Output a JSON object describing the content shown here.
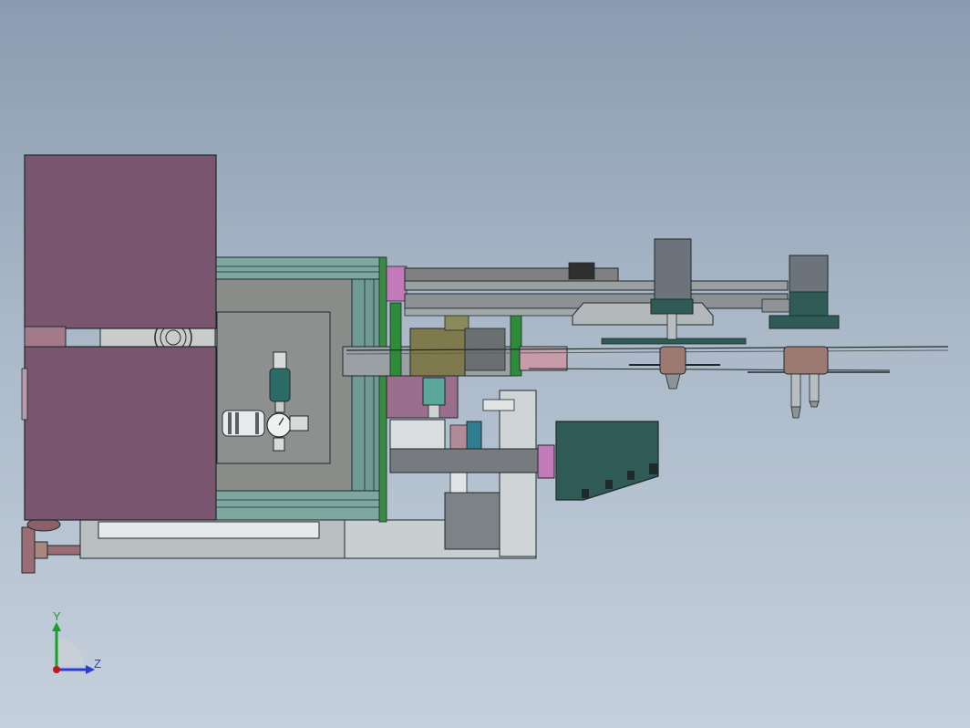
{
  "viewport": {
    "background_top": "#8a9cb1",
    "background_bottom": "#c5d0dc"
  },
  "colors": {
    "cabinet_purple": "#795570",
    "frame_teal": "#7ea89f",
    "panel_gray": "#8a8c8a",
    "outline": "#1f2a2a",
    "green_part": "#2e8b3a",
    "dark_teal": "#2f5a55",
    "pink_flange": "#c27ab8",
    "rail_gray": "#808080",
    "motor_gray": "#6d737a",
    "base_light": "#b9bfc0"
  },
  "triad": {
    "y_label": "Y",
    "z_label": "Z",
    "y_color": "#1a9e2a",
    "z_color": "#2a3fd0",
    "x_color": "#c01818"
  }
}
